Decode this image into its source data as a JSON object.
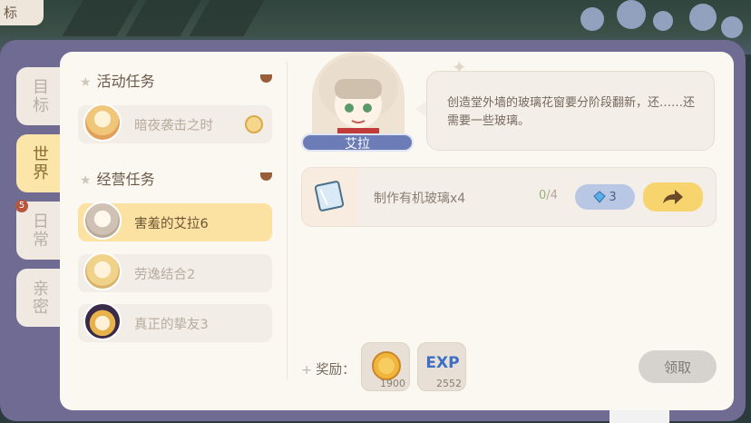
{
  "corner_tab": {
    "label": "标"
  },
  "side_tabs": [
    {
      "label": "目标",
      "active": false
    },
    {
      "label": "世界",
      "active": true
    },
    {
      "label": "日常",
      "active": false,
      "badge": "5"
    },
    {
      "label": "亲密",
      "active": false
    }
  ],
  "sections": [
    {
      "title": "活动任务",
      "tasks": [
        {
          "label": "暗夜袭击之时",
          "selected": false,
          "timed": true,
          "portrait_color": "#f0c77a"
        }
      ]
    },
    {
      "title": "经营任务",
      "tasks": [
        {
          "label": "害羞的艾拉6",
          "selected": true,
          "portrait_color": "#d9cfc4"
        },
        {
          "label": "劳逸结合2",
          "selected": false,
          "portrait_color": "#f0d28a"
        },
        {
          "label": "真正的挚友3",
          "selected": false,
          "portrait_color": "#e8b24a"
        }
      ]
    }
  ],
  "npc": {
    "name": "艾拉",
    "dialogue": "创造堂外墙的玻璃花窗要分阶段翻新，还……还需要一些玻璃。"
  },
  "objective": {
    "text": "制作有机玻璃x4",
    "progress_current": "0",
    "progress_total": "/4",
    "cost": "3",
    "icon": "glass-sheet-icon"
  },
  "reward": {
    "label": "奖励：",
    "items": [
      {
        "icon": "gold-coin-icon",
        "qty": "1900"
      },
      {
        "icon": "exp-icon",
        "text": "EXP",
        "qty": "2552"
      }
    ],
    "claim_label": "领取"
  },
  "colors": {
    "frame": "#6f6b92",
    "panel": "#fbf7f1",
    "selected_task": "#fbe2a2",
    "go_button": "#f8d46e",
    "cost_button": "#b8c7e3",
    "name_tag": "#6b7cb6"
  }
}
